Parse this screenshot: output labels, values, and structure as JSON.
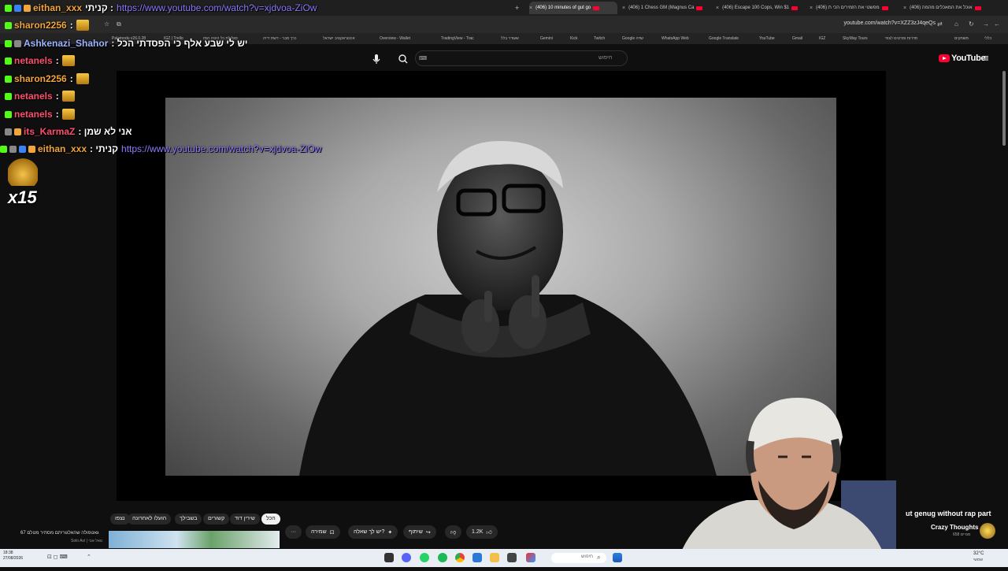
{
  "browser": {
    "tabs": [
      {
        "label": "(406) 10 minutes of gut go"
      },
      {
        "label": "(406) 1 Chess GM (Magnus Ca"
      },
      {
        "label": "(406) Escape 100 Cops, Win $1"
      },
      {
        "label": "(406) מפשטי את הזמירים הכי ת"
      },
      {
        "label": "(406) אוכל את המאכלים מהמה"
      }
    ],
    "url": "youtube.com/watch?v=XZZ3zJ4qeQs",
    "bookmarks": [
      "Palatnodu v26.0.28",
      "IGZ | Trello",
      "סגלולת כל היגיה המז",
      "כרך מבר - דשת דייה",
      "אינטראקטיב ישראל",
      "Overview - Wallet",
      "TradingView - Trac",
      "שעודר בלל",
      "Gemini",
      "Kick",
      "Twitch",
      "Google שדה",
      "WhatsApp Web",
      "Google Translate",
      "YouTube",
      "Gmail",
      "IGZ",
      "SkyWay Tours",
      "סדרות וסרטים לצפי",
      "משחקים",
      "כללי"
    ]
  },
  "youtube": {
    "logo": "YouTube",
    "search_placeholder": "חיפוש",
    "search_kbd": "⌨"
  },
  "chat": {
    "messages": [
      {
        "user": "eithan_xxx",
        "color": "#f2a53c",
        "text": "קניתי :",
        "link": "https://www.youtube.com/watch?v=xjdvoa-ZiOw"
      },
      {
        "user": "sharon2256",
        "color": "#f2a53c",
        "text": ":"
      },
      {
        "user": "Ashkenazi_Shahor",
        "color": "#9eb6ff",
        "text": ": יש לי שבע אלף כי הפסדתי הכל"
      },
      {
        "user": "netanels",
        "color": "#ff4d6d",
        "text": ":"
      },
      {
        "user": "sharon2256",
        "color": "#f2a53c",
        "text": ":"
      },
      {
        "user": "netanels",
        "color": "#ff4d6d",
        "text": ":"
      },
      {
        "user": "netanels",
        "color": "#ff4d6d",
        "text": ":"
      },
      {
        "user": "its_KarmaZ",
        "color": "#ff4d6d",
        "text": ": אני לא שמן"
      },
      {
        "user": "eithan_xxx",
        "color": "#f2a53c",
        "text": ": קניתי",
        "link": "https://www.youtube.com/watch?v=xjdvoa-ZiOw"
      }
    ],
    "combo_count": "x15"
  },
  "below_video": {
    "chips": [
      "הכל",
      "שירין דוד",
      "קשורים",
      "בשבילך",
      "הועלו לאחרונה",
      "נצפו"
    ],
    "actions": {
      "likes": "1.2K",
      "share": "שיתוף",
      "ask": "יש לך שאלה?",
      "save": "שמירה",
      "more": "···"
    },
    "rec_title": "גאטפולה שהאלגוריתם מסתיר מטלם 67",
    "rec_channel": "Solo Aví | טאל אבי",
    "right_rec_title": "ut genug without rap part",
    "channel_name": "Crazy Thoughts",
    "channel_subs": "658 מנויים"
  },
  "taskbar": {
    "time": "18:38",
    "date": "27/08/2026",
    "search": "חיפוש",
    "weather": "32°C",
    "weather_sub": "שמשי"
  }
}
